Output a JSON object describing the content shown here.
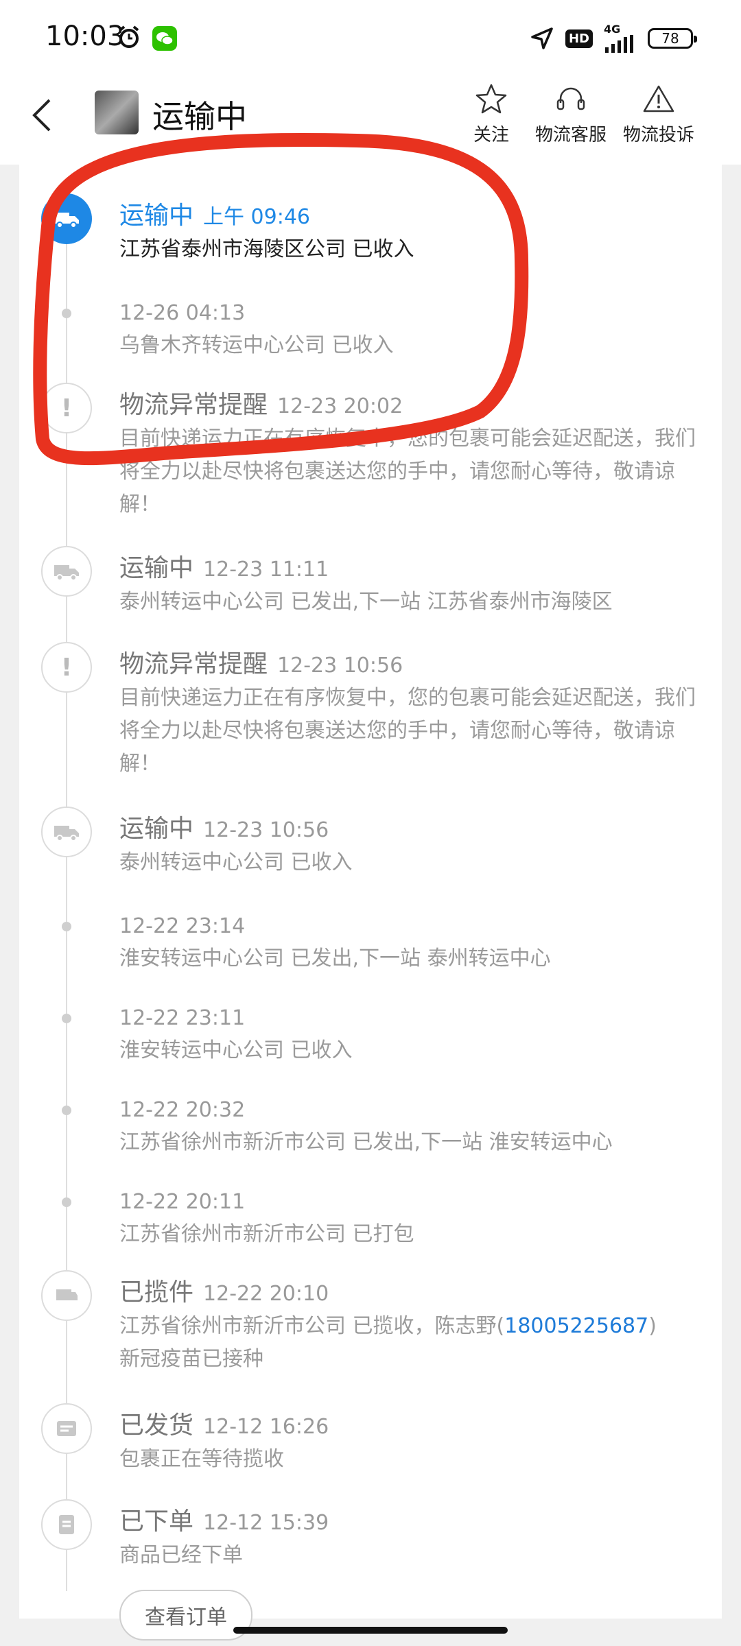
{
  "status_bar": {
    "time": "10:03",
    "network": "4G",
    "hd": "HD",
    "battery": "78"
  },
  "header": {
    "title": "运输中",
    "actions": [
      {
        "label": "关注",
        "icon": "star-icon"
      },
      {
        "label": "物流客服",
        "icon": "headset-icon"
      },
      {
        "label": "物流投诉",
        "icon": "warning-icon"
      }
    ]
  },
  "events": [
    {
      "status": "运输中",
      "time": "上午 09:46",
      "text": "江苏省泰州市海陵区公司 已收入",
      "icon": "truck-icon",
      "active": true
    },
    {
      "status": "",
      "time": "12-26 04:13",
      "text": "乌鲁木齐转运中心公司 已收入",
      "icon": "dot"
    },
    {
      "status": "物流异常提醒",
      "time": "12-23 20:02",
      "text": "目前快递运力正在有序恢复中，您的包裹可能会延迟配送，我们将全力以赴尽快将包裹送达您的手中，请您耐心等待，敬请谅解！",
      "icon": "exclamation-icon"
    },
    {
      "status": "运输中",
      "time": "12-23 11:11",
      "text": "泰州转运中心公司 已发出,下一站 江苏省泰州市海陵区",
      "icon": "truck-icon"
    },
    {
      "status": "物流异常提醒",
      "time": "12-23 10:56",
      "text": "目前快递运力正在有序恢复中，您的包裹可能会延迟配送，我们将全力以赴尽快将包裹送达您的手中，请您耐心等待，敬请谅解！",
      "icon": "exclamation-icon"
    },
    {
      "status": "运输中",
      "time": "12-23 10:56",
      "text": "泰州转运中心公司 已收入",
      "icon": "truck-icon"
    },
    {
      "status": "",
      "time": "12-22 23:14",
      "text": "淮安转运中心公司 已发出,下一站 泰州转运中心",
      "icon": "dot"
    },
    {
      "status": "",
      "time": "12-22 23:11",
      "text": "淮安转运中心公司 已收入",
      "icon": "dot"
    },
    {
      "status": "",
      "time": "12-22 20:32",
      "text": "江苏省徐州市新沂市公司 已发出,下一站 淮安转运中心",
      "icon": "dot"
    },
    {
      "status": "",
      "time": "12-22 20:11",
      "text": "江苏省徐州市新沂市公司 已打包",
      "icon": "dot"
    },
    {
      "status": "已揽件",
      "time": "12-22 20:10",
      "text": "江苏省徐州市新沂市公司 已揽收，陈志野(",
      "phone": "18005225687",
      "text_after": ")",
      "text2": "新冠疫苗已接种",
      "icon": "package-icon"
    },
    {
      "status": "已发货",
      "time": "12-12 16:26",
      "text": "包裹正在等待揽收",
      "icon": "box-icon"
    },
    {
      "status": "已下单",
      "time": "12-12 15:39",
      "text": "商品已经下单",
      "icon": "document-icon"
    }
  ],
  "view_order_label": "查看订单",
  "colors": {
    "accent": "#1e88e5",
    "annotation": "#e8321f"
  }
}
